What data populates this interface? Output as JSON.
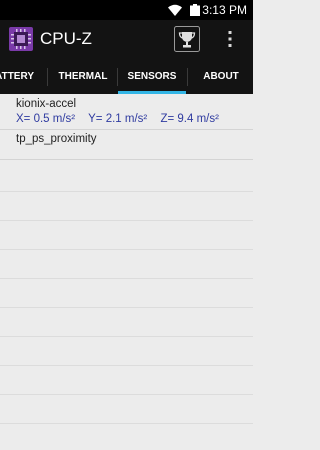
{
  "status_bar": {
    "time": "3:13 PM"
  },
  "app_bar": {
    "title": "CPU-Z"
  },
  "tabs": [
    {
      "label": "ATTERY",
      "active": false
    },
    {
      "label": "THERMAL",
      "active": false
    },
    {
      "label": "SENSORS",
      "active": true
    },
    {
      "label": "ABOUT",
      "active": false
    }
  ],
  "sensors": [
    {
      "name": "kionix-accel",
      "values": {
        "x": "X= 0.5 m/s²",
        "y": "Y= 2.1 m/s²",
        "z": "Z= 9.4 m/s²"
      }
    },
    {
      "name": "tp_ps_proximity"
    }
  ],
  "colors": {
    "background": "#ececec",
    "app_bar": "#131313",
    "accent": "#33b5e5",
    "value_text": "#2f3ba0"
  },
  "icons": {
    "wifi": "wifi-icon",
    "battery": "battery-icon",
    "logo": "cpu-chip-icon",
    "trophy": "trophy-icon",
    "overflow": "more-vert-icon"
  }
}
